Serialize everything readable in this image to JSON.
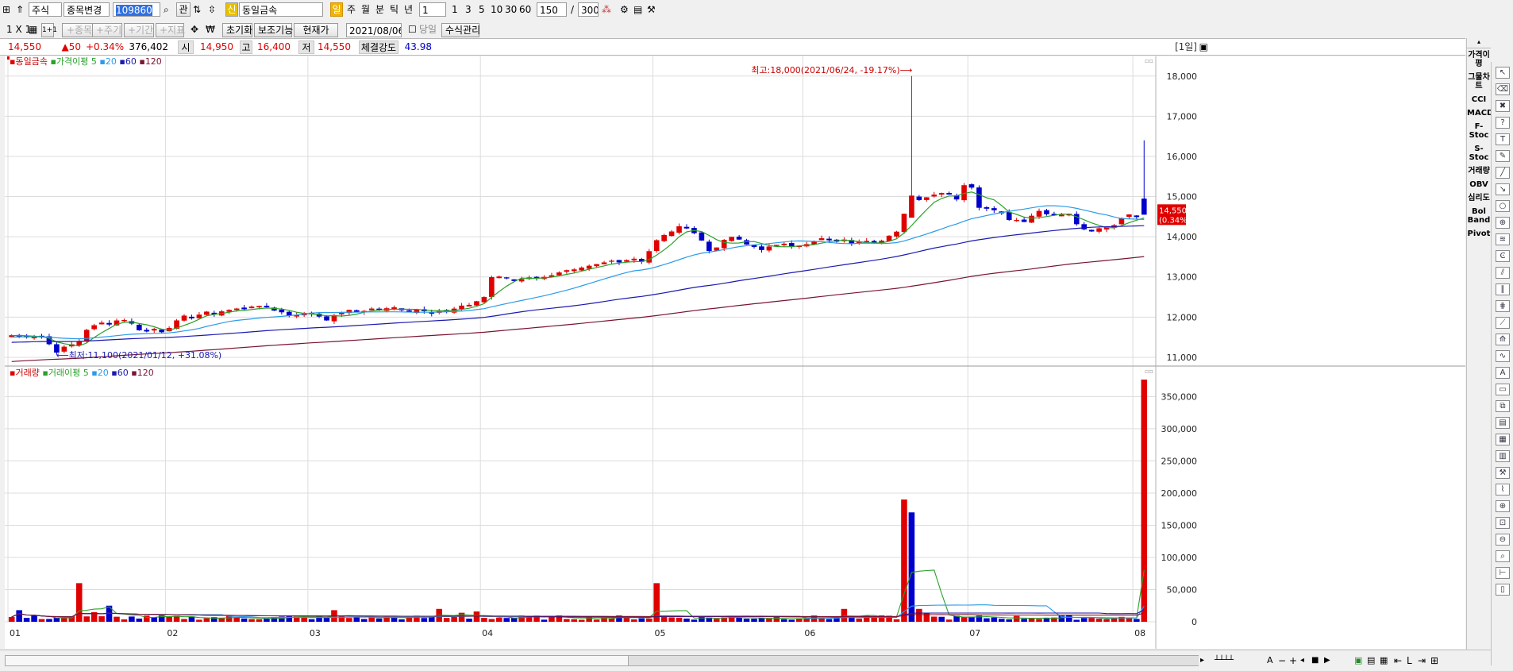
{
  "toolbar": {
    "market": "주식",
    "change_label": "종목변경",
    "code": "109860",
    "kwan": "관",
    "credit_mark": "신",
    "stock_name": "동일금속",
    "periods": [
      "일",
      "주",
      "월",
      "분",
      "틱",
      "년"
    ],
    "minute_value": "1",
    "minute_presets": [
      "1",
      "3",
      "5",
      "10",
      "30",
      "60"
    ],
    "count_value": "150",
    "slash": "/",
    "total_value": "300"
  },
  "toolbar2": {
    "layout": "1 X 1",
    "one_plus_one": "1+1",
    "disabled_buttons": [
      "+종목",
      "+주기",
      "+기간",
      "+지표"
    ],
    "won": "₩",
    "reset": "초기화",
    "aux": "보조기능",
    "price_type": "현재가",
    "date": "2021/08/06",
    "same_day": "당일",
    "formula": "수식관리"
  },
  "infobar": {
    "price": "14,550",
    "change": "▲50",
    "change_pct": "+0.34%",
    "volume": "376,402",
    "open_label": "시",
    "open": "14,950",
    "high_label": "고",
    "high": "16,400",
    "low_label": "저",
    "low": "14,550",
    "strength_label": "체결강도",
    "strength": "43.98",
    "period_tag": "[1일]"
  },
  "legend_price": [
    "동일금속",
    "가격이평",
    "5",
    "20",
    "60",
    "120"
  ],
  "legend_volume": [
    "거래량",
    "거래이평",
    "5",
    "20",
    "60",
    "120"
  ],
  "annot_high": "최고:18,000(2021/06/24, -19.17%)⟶",
  "annot_low": "⟵최저:11,100(2021/01/12, +31.08%)",
  "price_tag": [
    "14,550",
    "(0.34%)"
  ],
  "right_indicators": [
    "가격이평",
    "그물차트",
    "CCI",
    "MACD",
    "F-Stoc",
    "S-Stoc",
    "거래량",
    "OBV",
    "심리도",
    "Bol Band",
    "Pivot"
  ],
  "colors": {
    "up": "#e00000",
    "down": "#0000cc",
    "ma5": "#2aa02a",
    "ma20": "#2b9be8",
    "ma60": "#1a1ab0",
    "ma120": "#7a1430",
    "grid": "#dcdcdc"
  },
  "chart_data": [
    {
      "type": "candlestick",
      "y_ticks": [
        "18,000",
        "17,000",
        "16,000",
        "15,000",
        "14,000",
        "13,000",
        "12,000",
        "11,000"
      ],
      "ylim": [
        10900,
        18450
      ],
      "x_ticks": [
        "01",
        "02",
        "03",
        "04",
        "05",
        "06",
        "07",
        "08"
      ],
      "x_tick_index": [
        0,
        21,
        40,
        63,
        86,
        106,
        128,
        150
      ],
      "bar_count": 152,
      "series": [
        {
          "name": "5",
          "style": "line"
        },
        {
          "name": "20",
          "style": "line"
        },
        {
          "name": "60",
          "style": "line"
        },
        {
          "name": "120",
          "style": "line"
        }
      ],
      "close_path": [
        [
          0,
          11550
        ],
        [
          4,
          11500
        ],
        [
          6,
          11150
        ],
        [
          9,
          11400
        ],
        [
          10,
          11700
        ],
        [
          12,
          11850
        ],
        [
          15,
          11950
        ],
        [
          17,
          11700
        ],
        [
          20,
          11650
        ],
        [
          23,
          12000
        ],
        [
          26,
          12100
        ],
        [
          30,
          12200
        ],
        [
          34,
          12250
        ],
        [
          37,
          12050
        ],
        [
          40,
          12100
        ],
        [
          42,
          11950
        ],
        [
          45,
          12150
        ],
        [
          49,
          12200
        ],
        [
          53,
          12200
        ],
        [
          58,
          12150
        ],
        [
          61,
          12300
        ],
        [
          63,
          12500
        ],
        [
          64,
          13000
        ],
        [
          67,
          12950
        ],
        [
          70,
          13000
        ],
        [
          75,
          13150
        ],
        [
          80,
          13400
        ],
        [
          84,
          13400
        ],
        [
          86,
          13900
        ],
        [
          88,
          14150
        ],
        [
          90,
          14300
        ],
        [
          92,
          13900
        ],
        [
          93,
          13650
        ],
        [
          96,
          14000
        ],
        [
          98,
          13800
        ],
        [
          100,
          13700
        ],
        [
          103,
          13800
        ],
        [
          106,
          13800
        ],
        [
          108,
          13950
        ],
        [
          112,
          13850
        ],
        [
          116,
          13900
        ],
        [
          118,
          14100
        ],
        [
          119,
          14600
        ],
        [
          121,
          14950
        ],
        [
          123,
          15050
        ],
        [
          125,
          15100
        ],
        [
          126,
          14950
        ],
        [
          127,
          15300
        ],
        [
          128,
          15200
        ],
        [
          129,
          14750
        ],
        [
          131,
          14700
        ],
        [
          133,
          14450
        ],
        [
          135,
          14400
        ],
        [
          137,
          14650
        ],
        [
          139,
          14550
        ],
        [
          141,
          14500
        ],
        [
          143,
          14150
        ],
        [
          145,
          14200
        ],
        [
          147,
          14300
        ],
        [
          148,
          14500
        ],
        [
          150,
          14550
        ]
      ],
      "high_annotation": {
        "index": 120,
        "value": 18000
      },
      "low_annotation": {
        "index": 7,
        "value": 11100
      },
      "last_candle": {
        "open": 14950,
        "high": 16400,
        "low": 14550,
        "close": 14550
      }
    },
    {
      "type": "bar",
      "y_ticks": [
        "350,000",
        "300,000",
        "250,000",
        "200,000",
        "150,000",
        "100,000",
        "50,000",
        "0"
      ],
      "ylim": [
        0,
        390000
      ],
      "spikes": [
        [
          1,
          18000
        ],
        [
          9,
          60000
        ],
        [
          11,
          15000
        ],
        [
          13,
          25000
        ],
        [
          43,
          18000
        ],
        [
          57,
          20000
        ],
        [
          60,
          14000
        ],
        [
          62,
          16000
        ],
        [
          86,
          60000
        ],
        [
          111,
          20000
        ],
        [
          119,
          190000
        ],
        [
          120,
          170000
        ],
        [
          121,
          20000
        ],
        [
          122,
          14000
        ],
        [
          151,
          376402
        ]
      ],
      "series": [
        {
          "name": "5",
          "style": "line"
        },
        {
          "name": "20",
          "style": "line"
        },
        {
          "name": "60",
          "style": "line"
        },
        {
          "name": "120",
          "style": "line"
        }
      ]
    }
  ]
}
